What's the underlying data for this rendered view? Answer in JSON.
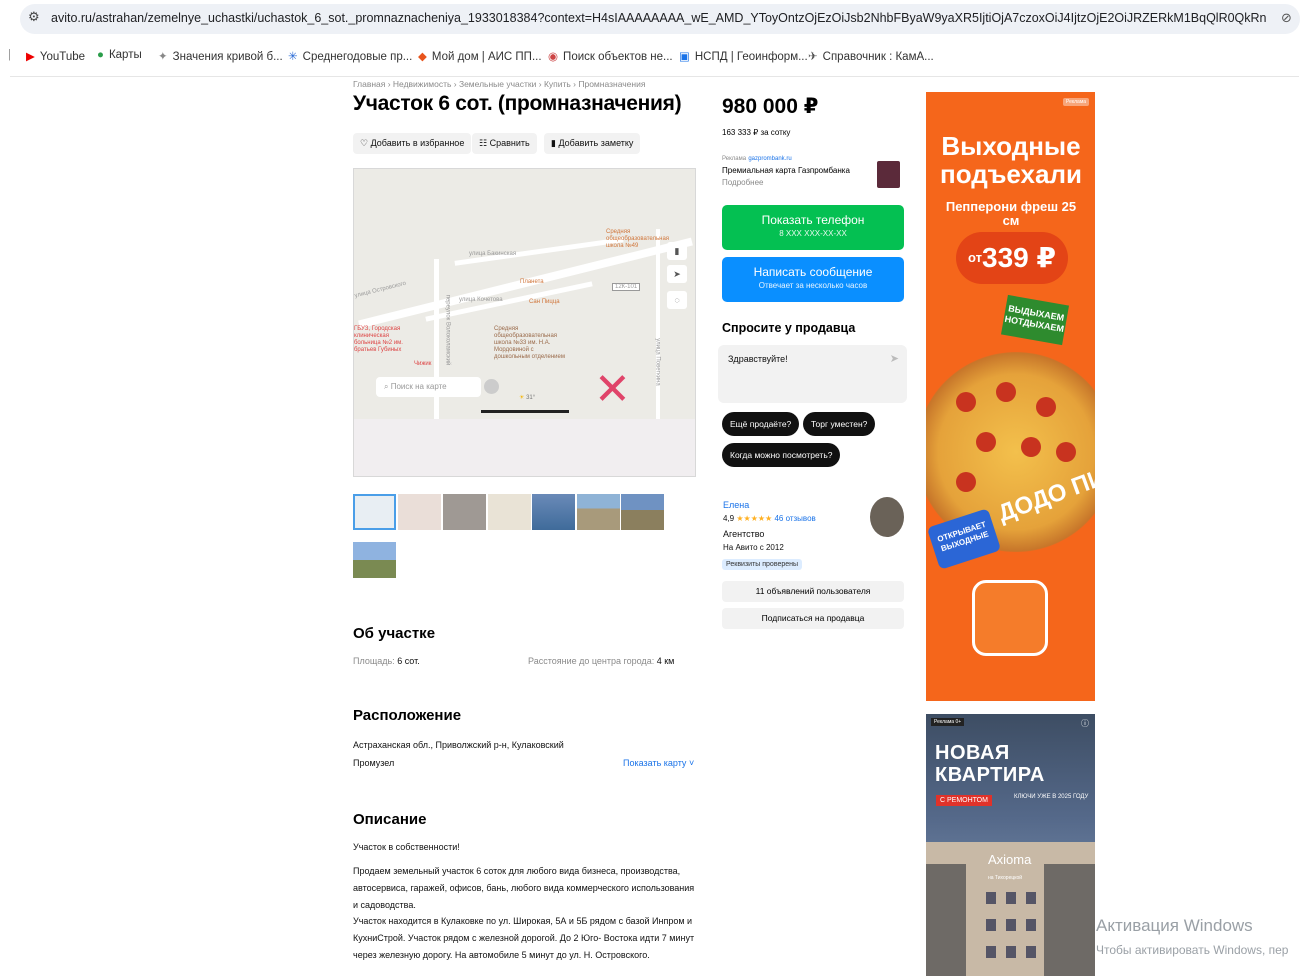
{
  "browser": {
    "url": "avito.ru/astrahan/zemelnye_uchastki/uchastok_6_sot._promnaznacheniya_1933018384?context=H4sIAAAAAAAA_wE_AMD_YToyOntzOjEzOiJsb2NhbFByaW9yaXR5IjtiOjA7czoxOiJ4IjtzOjE2OiJRZERkM1BqQlR0QkRnUUJmljt9BeD0Pj8AAA..."
  },
  "bookmarks": [
    {
      "label": "YouTube",
      "icon": "youtube-icon"
    },
    {
      "label": "Карты",
      "icon": "maps-pin-icon"
    },
    {
      "label": "Значения кривой б...",
      "icon": "emblem-icon"
    },
    {
      "label": "Среднегодовые пр...",
      "icon": "snowflake-icon"
    },
    {
      "label": "Мой дом | АИС ПП...",
      "icon": "diamond-icon"
    },
    {
      "label": "Поиск объектов не...",
      "icon": "globe-icon"
    },
    {
      "label": "НСПД | Геоинформ...",
      "icon": "doc-icon"
    },
    {
      "label": "Справочник : КамА...",
      "icon": "truck-icon"
    }
  ],
  "listing": {
    "breadcrumb": "Главная › Недвижимость › Земельные участки › Купить › Промназначения",
    "title": "Участок 6 сот. (промназначения)",
    "actions": {
      "favorite": "Добавить в избранное",
      "compare": "Сравнить",
      "note": "Добавить заметку"
    }
  },
  "map": {
    "search_placeholder": "Поиск на карте",
    "labels": {
      "street1": "улица Бакинская",
      "street2": "улица Кочетова",
      "street3": "улица Островского",
      "street4": "переулок Волоколамский",
      "street5": "улица Поветкина",
      "school49": "Средняя общеобразовательная школа №49",
      "school33": "Средняя общеобразовательная школа №33 им. Н.А. Мордовиной с дошкольным отделением",
      "hospital": "ГБУЗ, Городская клиническая больница №2 им. братьев Губиных",
      "planet": "Планета",
      "sanpizza": "Сан Пицца",
      "chizhik": "Чижик",
      "temp": "31°",
      "road": "12К-101"
    }
  },
  "about": {
    "heading": "Об участке",
    "area_label": "Площадь:",
    "area_value": "6 сот.",
    "distance_label": "Расстояние до центра города:",
    "distance_value": "4 км"
  },
  "location": {
    "heading": "Расположение",
    "address": "Астраханская обл., Приволжский р-н, Кулаковский",
    "district": "Промузел",
    "show_map": "Показать карту"
  },
  "description": {
    "heading": "Описание",
    "p1": "Участок в собственности!",
    "p2": "Продаем земельный участок 6 соток для любого вида бизнеса, производства, автосервиса, гаражей, офисов, бань, любого вида коммерческого использования и садоводства.",
    "p3": "Участок находится в Кулаковке по ул. Широкая, 5А и 5Б рядом с базой Инпром и КухниСтрой. Участок рядом с железной дорогой. До 2 Юго- Востока идти 7 минут через железную дорогу. На автомобиле 5 минут до ул. Н. Островского."
  },
  "sidebar": {
    "price": "980 000 ₽",
    "price_per": "163 333 ₽ за сотку",
    "ad_label": "Реклама",
    "ad_domain": "gazprombank.ru",
    "ad_title": "Премиальная карта Газпромбанка",
    "ad_more": "Подробнее",
    "phone_btn": "Показать телефон",
    "phone_sub": "8 XXX XXX-XX-XX",
    "msg_btn": "Написать сообщение",
    "msg_sub": "Отвечает за несколько часов",
    "ask_heading": "Спросите у продавца",
    "ask_placeholder": "Здравствуйте!",
    "chips": [
      "Ещё продаёте?",
      "Торг уместен?",
      "Когда можно посмотреть?"
    ],
    "seller_name": "Елена",
    "seller_rating": "4,9",
    "seller_stars": "★★★★★",
    "seller_reviews": "46 отзывов",
    "seller_type": "Агентство",
    "seller_since": "На Авито с 2012",
    "verified": "Реквизиты проверены",
    "listings_btn": "11 объявлений пользователя",
    "subscribe_btn": "Подписаться на продавца"
  },
  "banner1": {
    "tag": "Реклама",
    "headline": "Выходные подъехали",
    "product": "Пепперони фреш 25 см",
    "price_from": "от",
    "price": "339 ₽",
    "sticker": "ВЫДЫХАЕМ НОТДЫХАЕМ",
    "brand": "ДОДО ПИ",
    "badge": "ОТКРЫВАЕТ ВЫХОДНЫЕ"
  },
  "banner2": {
    "tag": "Реклама 0+",
    "headline": "НОВАЯ КВАРТИРА",
    "repair": "С РЕМОНТОМ",
    "keys": "КЛЮЧИ УЖЕ В 2025 ГОДУ",
    "brand": "Axioma",
    "brand_sub": "на Тихорецкой"
  },
  "os_watermark": {
    "line1": "Активация Windows",
    "line2": "Чтобы активировать Windows, пер"
  },
  "colors": {
    "green": "#04c052",
    "blue": "#0a8fff",
    "link": "#1a73e8",
    "orange": "#f5661b"
  }
}
